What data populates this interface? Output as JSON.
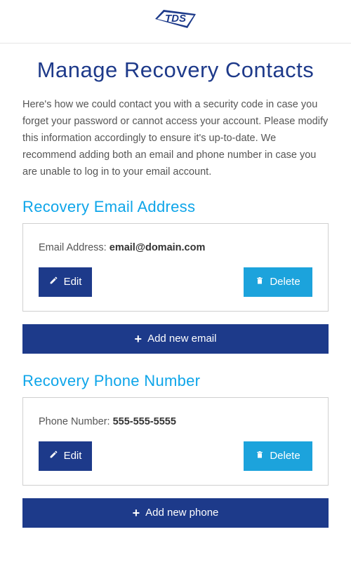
{
  "logo_text": "TDS",
  "page_title": "Manage Recovery Contacts",
  "intro_text": "Here's how we could contact you with a security code in case you forget your password or cannot access your account. Please modify this information accordingly to ensure it's up-to-date. We recommend adding both an email and phone number in case you are unable to log in to your email account.",
  "sections": {
    "email": {
      "heading": "Recovery Email Address",
      "label": "Email Address: ",
      "value": "email@domain.com",
      "edit_label": "Edit",
      "delete_label": "Delete",
      "add_label": "Add new email"
    },
    "phone": {
      "heading": "Recovery Phone Number",
      "label": "Phone Number: ",
      "value": "555-555-5555",
      "edit_label": "Edit",
      "delete_label": "Delete",
      "add_label": "Add new phone"
    }
  }
}
